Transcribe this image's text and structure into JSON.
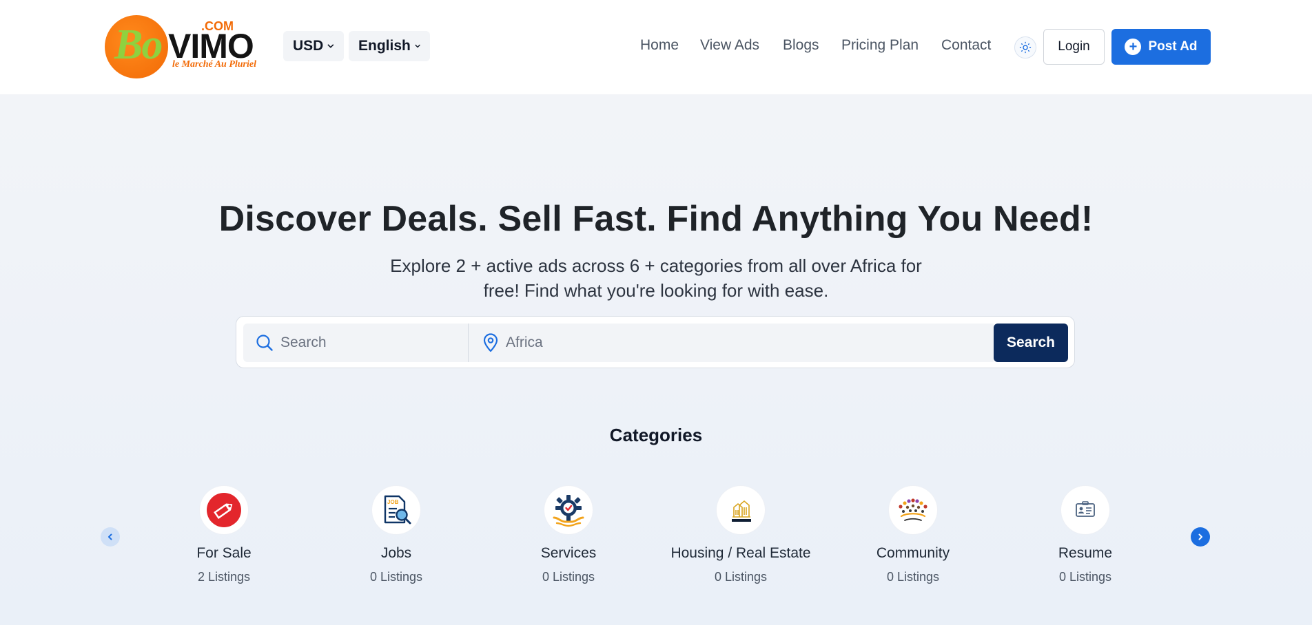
{
  "brand": {
    "logo_bo": "Bo",
    "logo_vimo": "VIMO",
    "logo_com": ".COM",
    "logo_tagline": "le Marché Au Pluriel"
  },
  "header": {
    "currency": "USD",
    "language": "English",
    "nav": [
      {
        "label": "Home"
      },
      {
        "label": "View Ads"
      },
      {
        "label": "Blogs"
      },
      {
        "label": "Pricing Plan"
      },
      {
        "label": "Contact"
      }
    ],
    "login_label": "Login",
    "post_ad_label": "Post Ad"
  },
  "hero": {
    "title": "Discover Deals. Sell Fast. Find Anything You Need!",
    "subtitle": "Explore 2 + active ads across 6 + categories from all over Africa for free! Find what you're looking for with ease."
  },
  "search": {
    "keyword_placeholder": "Search",
    "location_placeholder": "Africa",
    "button_label": "Search"
  },
  "categories": {
    "title": "Categories",
    "items": [
      {
        "name": "For Sale",
        "count": "2 Listings",
        "icon": "price-tag-icon"
      },
      {
        "name": "Jobs",
        "count": "0 Listings",
        "icon": "job-search-icon"
      },
      {
        "name": "Services",
        "count": "0 Listings",
        "icon": "gear-service-icon"
      },
      {
        "name": "Housing / Real Estate",
        "count": "0 Listings",
        "icon": "real-estate-icon"
      },
      {
        "name": "Community",
        "count": "0 Listings",
        "icon": "community-icon"
      },
      {
        "name": "Resume",
        "count": "0 Listings",
        "icon": "resume-card-icon"
      }
    ]
  },
  "colors": {
    "primary": "#1c6ee0",
    "search_button": "#0c2a5c",
    "brand_orange": "#f26a06",
    "brand_green": "#8fd13f"
  }
}
